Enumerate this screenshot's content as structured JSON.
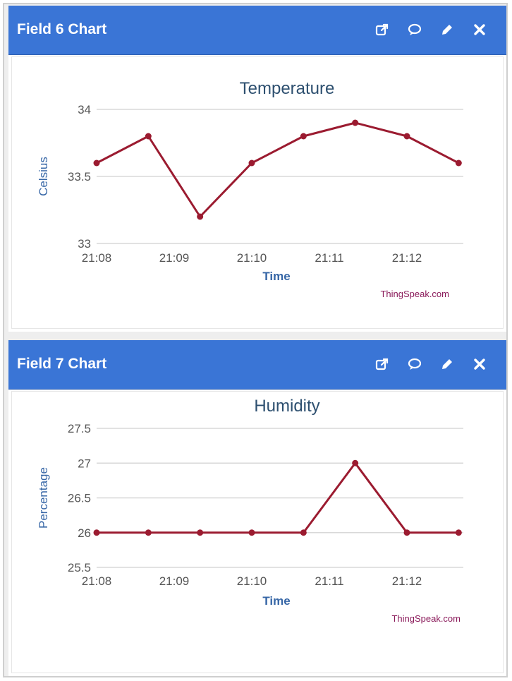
{
  "panels": [
    {
      "header_title": "Field 6 Chart",
      "icons": [
        "external-link-icon",
        "comment-icon",
        "edit-pencil-icon",
        "close-icon"
      ],
      "chart_data": {
        "type": "line",
        "title": "Temperature",
        "xlabel": "Time",
        "ylabel": "Celsius",
        "credit": "ThingSpeak.com",
        "x_ticks": [
          "21:08",
          "21:09",
          "21:10",
          "21:11",
          "21:12"
        ],
        "y_ticks": [
          "34",
          "33.5",
          "33"
        ],
        "ylim": [
          33,
          34
        ],
        "series": [
          {
            "x": [
              "21:08:00",
              "21:08:40",
              "21:09:20",
              "21:10:00",
              "21:10:40",
              "21:11:20",
              "21:12:00",
              "21:12:40"
            ],
            "values": [
              33.6,
              33.8,
              33.2,
              33.6,
              33.8,
              33.9,
              33.8,
              33.6
            ]
          }
        ],
        "line_color": "#9b1b30",
        "grid": true
      }
    },
    {
      "header_title": "Field 7 Chart",
      "icons": [
        "external-link-icon",
        "comment-icon",
        "edit-pencil-icon",
        "close-icon"
      ],
      "chart_data": {
        "type": "line",
        "title": "Humidity",
        "xlabel": "Time",
        "ylabel": "Percentage",
        "credit": "ThingSpeak.com",
        "x_ticks": [
          "21:08",
          "21:09",
          "21:10",
          "21:11",
          "21:12"
        ],
        "y_ticks": [
          "27.5",
          "27",
          "26.5",
          "26",
          "25.5"
        ],
        "ylim": [
          25.5,
          27.5
        ],
        "series": [
          {
            "x": [
              "21:08:00",
              "21:08:40",
              "21:09:20",
              "21:10:00",
              "21:10:40",
              "21:11:20",
              "21:12:00",
              "21:12:40"
            ],
            "values": [
              26,
              26,
              26,
              26,
              26,
              27,
              26,
              26
            ]
          }
        ],
        "line_color": "#9b1b30",
        "grid": true
      }
    }
  ],
  "colors": {
    "header_bg": "#3a75d6",
    "title_text": "#2d4f6f",
    "axis_label_text": "#3666a6",
    "tick_text": "#555555",
    "grid": "#d8d8d8",
    "credit_text": "#8a1a5a"
  }
}
